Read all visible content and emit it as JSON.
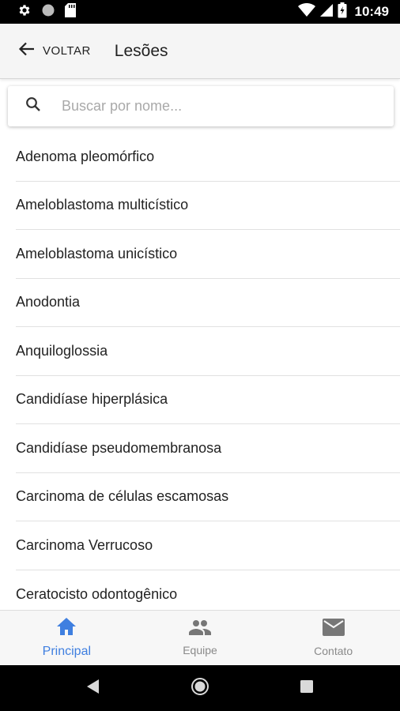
{
  "status_bar": {
    "time": "10:49"
  },
  "app_bar": {
    "back_label": "VOLTAR",
    "title": "Lesões"
  },
  "search": {
    "placeholder": "Buscar por nome...",
    "value": ""
  },
  "list": {
    "items": [
      "Adenoma pleomórfico",
      "Ameloblastoma multicístico",
      "Ameloblastoma unicístico",
      "Anodontia",
      "Anquiloglossia",
      "Candidíase hiperplásica",
      "Candidíase pseudomembranosa",
      "Carcinoma de células escamosas",
      "Carcinoma Verrucoso",
      "Ceratocisto odontogênico"
    ]
  },
  "tabs": [
    {
      "label": "Principal",
      "icon": "home-icon",
      "active": true
    },
    {
      "label": "Equipe",
      "icon": "people-icon",
      "active": false
    },
    {
      "label": "Contato",
      "icon": "mail-icon",
      "active": false
    }
  ],
  "colors": {
    "accent": "#3f7fe0",
    "inactive": "#8a8a8a"
  }
}
